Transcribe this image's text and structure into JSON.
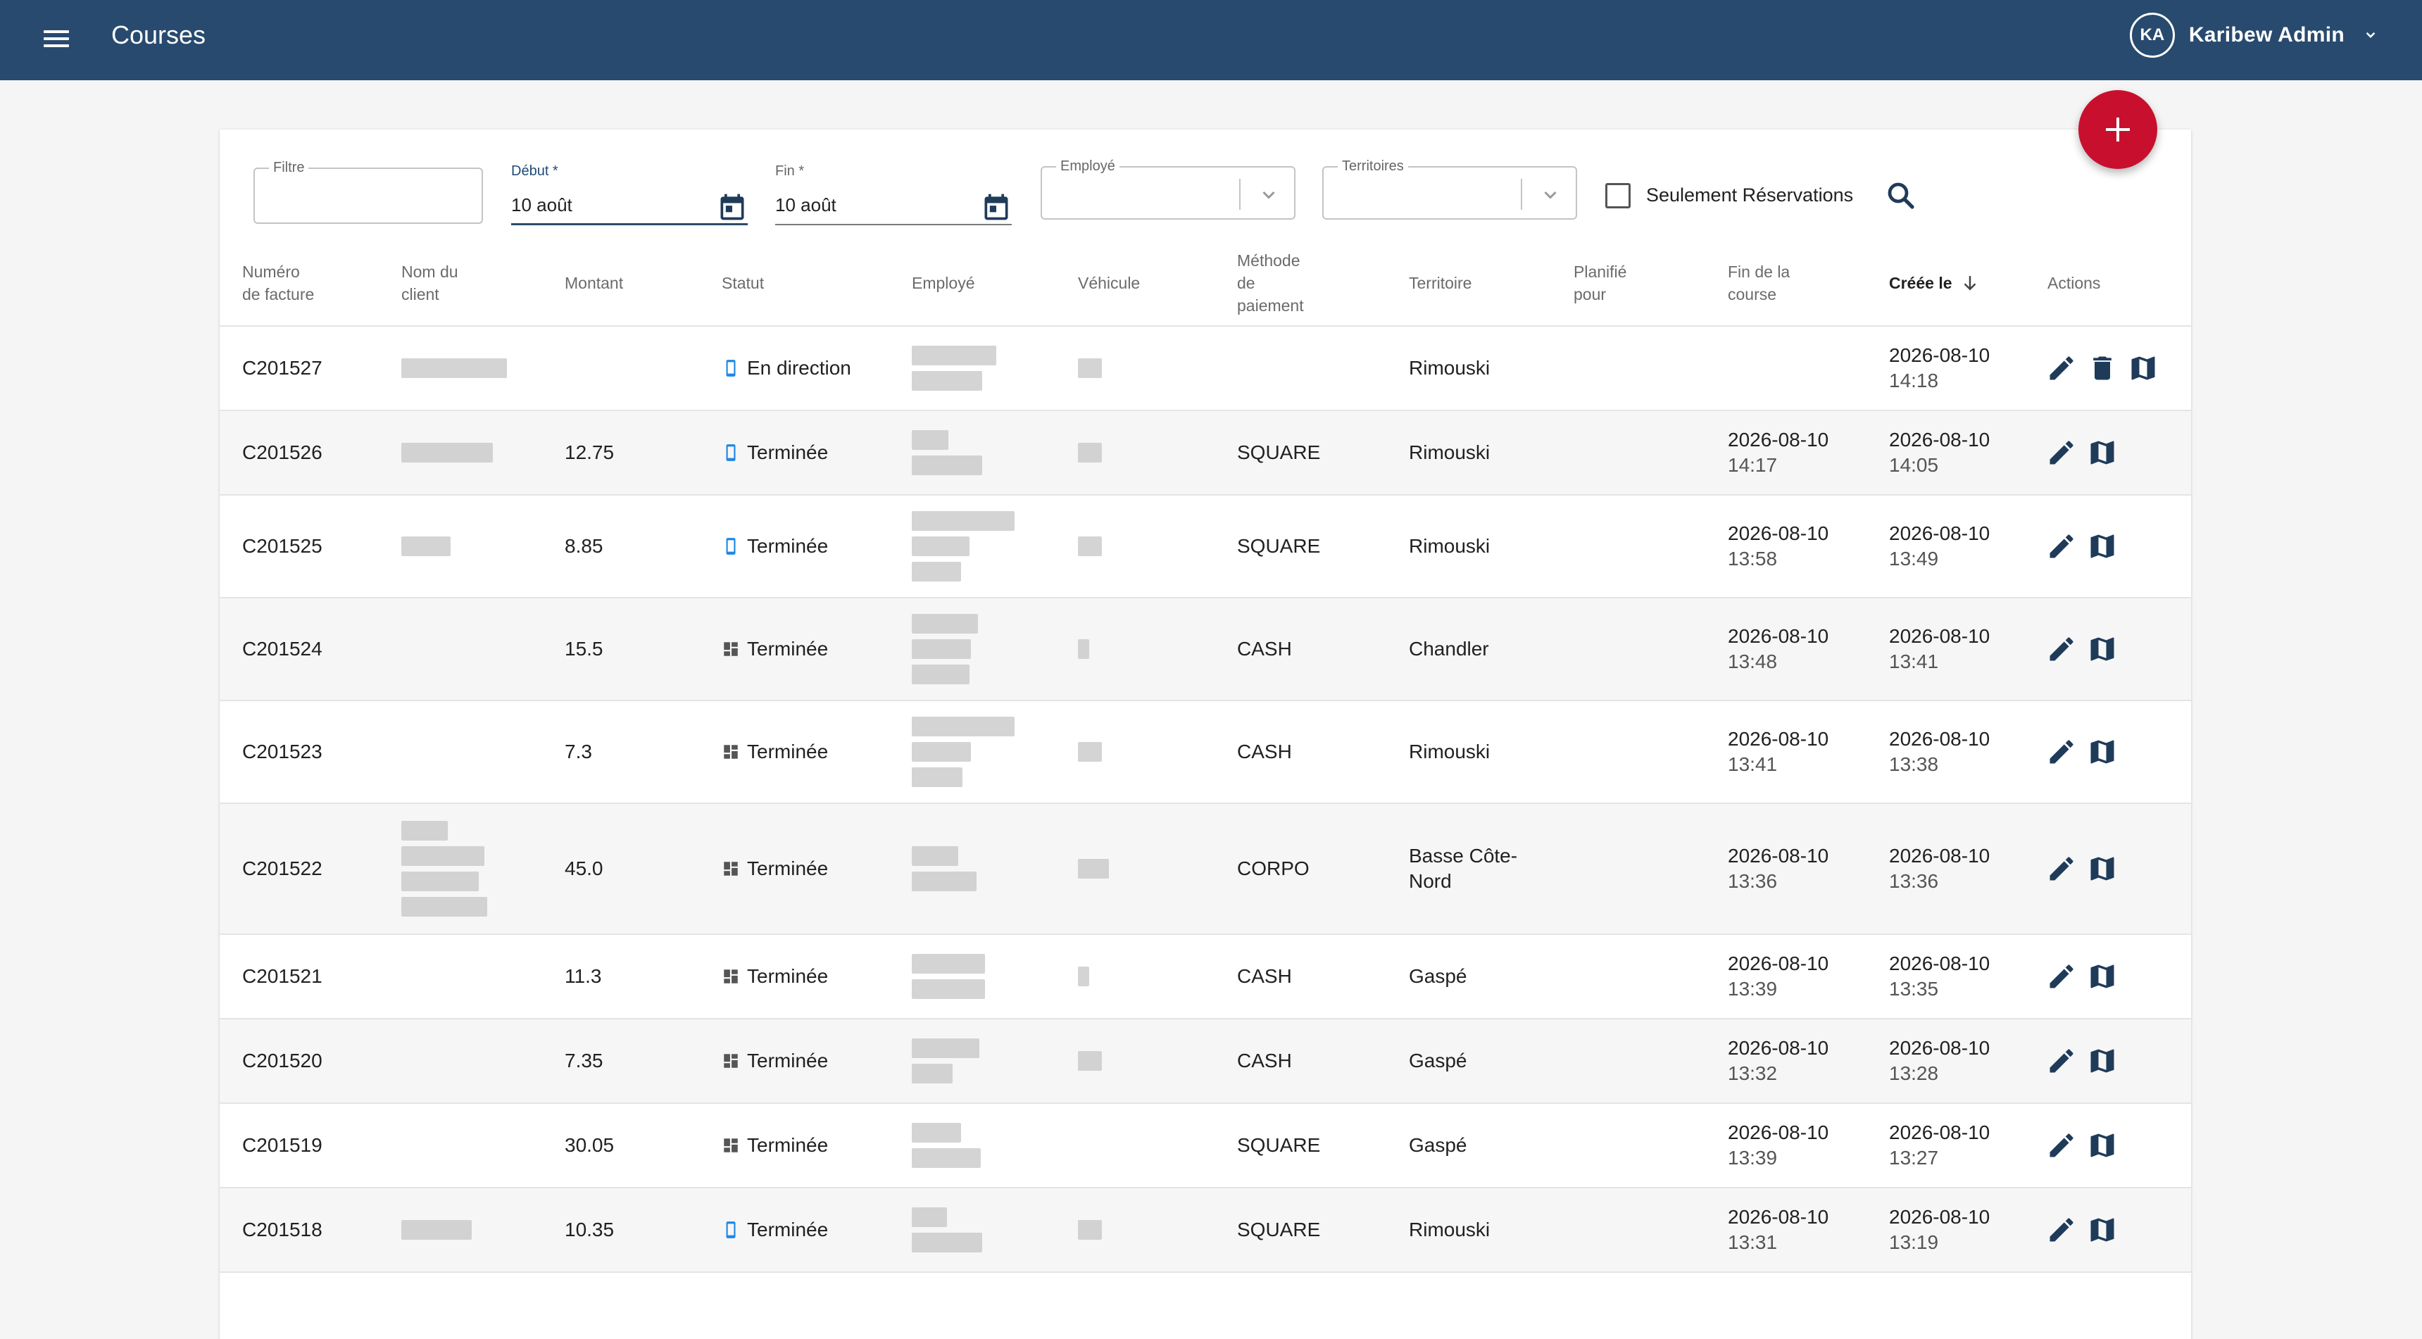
{
  "appbar": {
    "title": "Courses",
    "user_initials": "KA",
    "user_name": "Karibew Admin"
  },
  "filters": {
    "filtre_label": "Filtre",
    "debut_label": "Début *",
    "debut_value": "10 août",
    "fin_label": "Fin *",
    "fin_value": "10 août",
    "employe_label": "Employé",
    "territoires_label": "Territoires",
    "reservations_label": "Seulement Réservations",
    "reservations_checked": false
  },
  "table": {
    "headers": {
      "numero": "Numéro de facture",
      "client": "Nom du client",
      "montant": "Montant",
      "statut": "Statut",
      "employe": "Employé",
      "vehicule": "Véhicule",
      "methode": "Méthode de paiement",
      "territoire": "Territoire",
      "planifie": "Planifié pour",
      "fin": "Fin de la course",
      "creee": "Créée le",
      "actions": "Actions"
    },
    "sorted_by": "creee",
    "sort_direction": "desc",
    "rows": [
      {
        "numero": "C201527",
        "montant": "",
        "statut": "En direction",
        "statut_icon": "phone-icon",
        "methode": "",
        "territoire": "Rimouski",
        "fin_date": "",
        "fin_time": "",
        "creee_date": "2026-08-10",
        "creee_time": "14:18",
        "deletable": true
      },
      {
        "numero": "C201526",
        "montant": "12.75",
        "statut": "Terminée",
        "statut_icon": "phone-icon",
        "methode": "SQUARE",
        "territoire": "Rimouski",
        "fin_date": "2026-08-10",
        "fin_time": "14:17",
        "creee_date": "2026-08-10",
        "creee_time": "14:05",
        "deletable": false
      },
      {
        "numero": "C201525",
        "montant": "8.85",
        "statut": "Terminée",
        "statut_icon": "phone-icon",
        "methode": "SQUARE",
        "territoire": "Rimouski",
        "fin_date": "2026-08-10",
        "fin_time": "13:58",
        "creee_date": "2026-08-10",
        "creee_time": "13:49",
        "deletable": false
      },
      {
        "numero": "C201524",
        "montant": "15.5",
        "statut": "Terminée",
        "statut_icon": "dashboard-icon",
        "methode": "CASH",
        "territoire": "Chandler",
        "fin_date": "2026-08-10",
        "fin_time": "13:48",
        "creee_date": "2026-08-10",
        "creee_time": "13:41",
        "deletable": false
      },
      {
        "numero": "C201523",
        "montant": "7.3",
        "statut": "Terminée",
        "statut_icon": "dashboard-icon",
        "methode": "CASH",
        "territoire": "Rimouski",
        "fin_date": "2026-08-10",
        "fin_time": "13:41",
        "creee_date": "2026-08-10",
        "creee_time": "13:38",
        "deletable": false
      },
      {
        "numero": "C201522",
        "montant": "45.0",
        "statut": "Terminée",
        "statut_icon": "dashboard-icon",
        "methode": "CORPO",
        "territoire": "Basse Côte-Nord",
        "fin_date": "2026-08-10",
        "fin_time": "13:36",
        "creee_date": "2026-08-10",
        "creee_time": "13:36",
        "deletable": false
      },
      {
        "numero": "C201521",
        "montant": "11.3",
        "statut": "Terminée",
        "statut_icon": "dashboard-icon",
        "methode": "CASH",
        "territoire": "Gaspé",
        "fin_date": "2026-08-10",
        "fin_time": "13:39",
        "creee_date": "2026-08-10",
        "creee_time": "13:35",
        "deletable": false
      },
      {
        "numero": "C201520",
        "montant": "7.35",
        "statut": "Terminée",
        "statut_icon": "dashboard-icon",
        "methode": "CASH",
        "territoire": "Gaspé",
        "fin_date": "2026-08-10",
        "fin_time": "13:32",
        "creee_date": "2026-08-10",
        "creee_time": "13:28",
        "deletable": false
      },
      {
        "numero": "C201519",
        "montant": "30.05",
        "statut": "Terminée",
        "statut_icon": "dashboard-icon",
        "methode": "SQUARE",
        "territoire": "Gaspé",
        "fin_date": "2026-08-10",
        "fin_time": "13:39",
        "creee_date": "2026-08-10",
        "creee_time": "13:27",
        "deletable": false
      },
      {
        "numero": "C201518",
        "montant": "10.35",
        "statut": "Terminée",
        "statut_icon": "phone-icon",
        "methode": "SQUARE",
        "territoire": "Rimouski",
        "fin_date": "2026-08-10",
        "fin_time": "13:31",
        "creee_date": "2026-08-10",
        "creee_time": "13:19",
        "deletable": false
      }
    ]
  },
  "colors": {
    "appbar": "#284a6e",
    "fab": "#c8102e",
    "phone_icon": "#1e88e5",
    "action_icon": "#1f3b5a"
  }
}
